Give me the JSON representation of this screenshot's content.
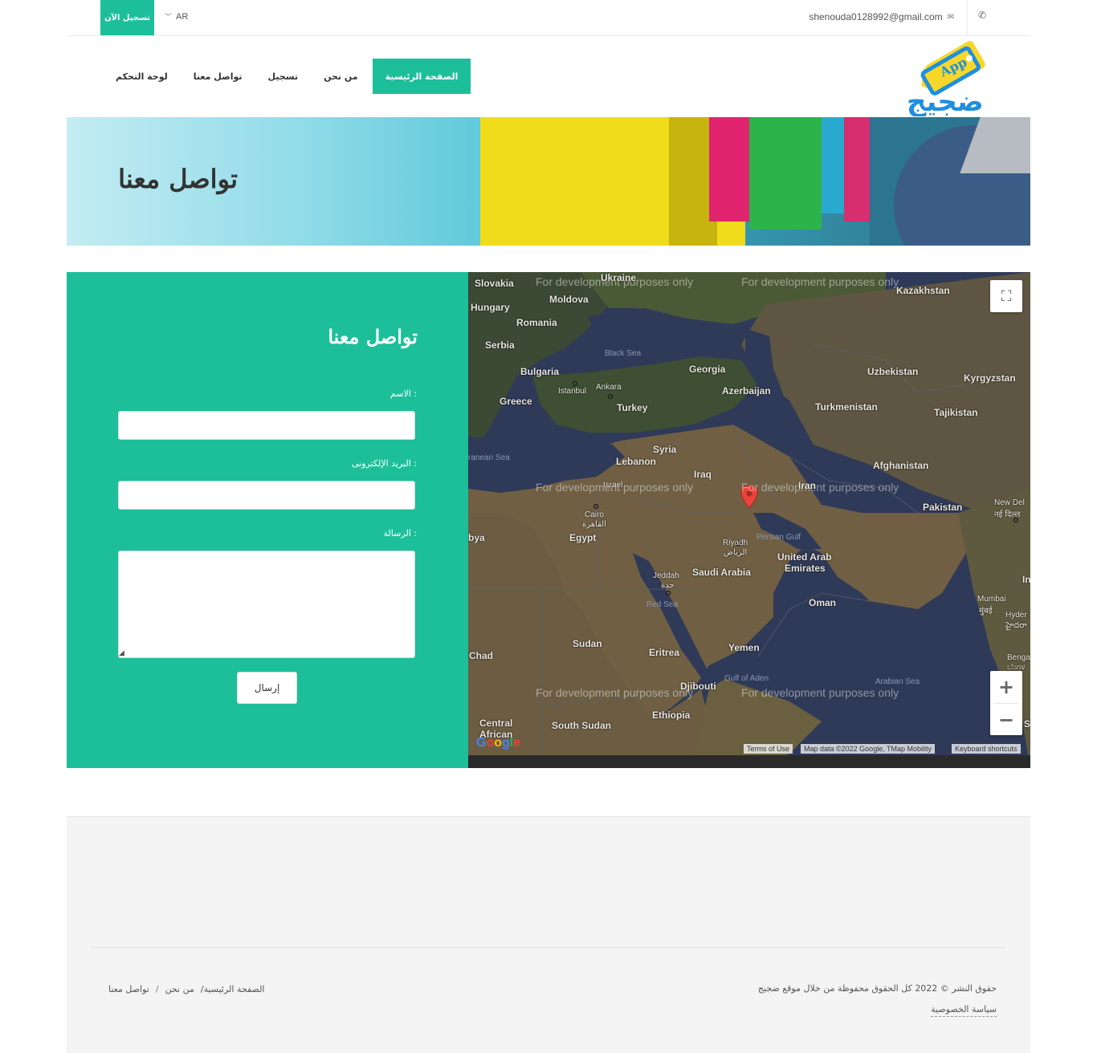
{
  "topbar": {
    "register_label": "تسجيل الآن",
    "language": "AR",
    "email": "shenouda0128992@gmail.com"
  },
  "nav": {
    "items": [
      {
        "label": "لوحة التحكم"
      },
      {
        "label": "تواصل معنا"
      },
      {
        "label": "تسجيل"
      },
      {
        "label": "من نحن"
      },
      {
        "label": "الصفحة الرئيسية",
        "active": true
      }
    ]
  },
  "logo": {
    "text": "ضجيج",
    "badge": "App"
  },
  "banner": {
    "title": "تواصل معنا"
  },
  "contact": {
    "title": "تواصل معنا",
    "name_label": "الاسم :",
    "email_label": "البريد الإلكترونى :",
    "message_label": "الرسالة :",
    "send_label": "إرسال"
  },
  "map": {
    "watermark": "For development purposes only",
    "labels": {
      "slovakia": "Slovakia",
      "ukraine": "Ukraine",
      "moldova": "Moldova",
      "hungary": "Hungary",
      "romania": "Romania",
      "serbia": "Serbia",
      "bulgaria": "Bulgaria",
      "greece": "Greece",
      "black_sea": "Black Sea",
      "georgia": "Georgia",
      "istanbul": "Istanbul",
      "ankara": "Ankara",
      "turkey": "Turkey",
      "azerbaijan": "Azerbaijan",
      "kazakhstan": "Kazakhstan",
      "uzbekistan": "Uzbekistan",
      "kyrgyzstan": "Kyrgyzstan",
      "turkmenistan": "Turkmenistan",
      "tajikistan": "Tajikistan",
      "med_sea": "ranean Sea",
      "syria": "Syria",
      "lebanon": "Lebanon",
      "iraq": "Iraq",
      "israel": "Israel",
      "afghanistan": "Afghanistan",
      "iran": "Iran",
      "pakistan": "Pakistan",
      "new_delhi": "New Del",
      "new_delhi_hi": "नई दिल्ल",
      "cairo": "Cairo",
      "cairo_ar": "القاهرة",
      "egypt": "Egypt",
      "libya": "bya",
      "riyadh": "Riyadh",
      "riyadh_ar": "الرياض",
      "persian_gulf": "Persian Gulf",
      "uae1": "United Arab",
      "uae2": "Emirates",
      "saudi": "Saudi Arabia",
      "jeddah": "Jeddah",
      "jeddah_ar": "جدة",
      "red_sea": "Red Sea",
      "oman": "Oman",
      "mumbai": "Mumbai",
      "mumbai_hi": "मुंबई",
      "hyder": "Hyder",
      "hyder_te": "హైదరా",
      "india": "In",
      "sudan": "Sudan",
      "eritrea": "Eritrea",
      "yemen": "Yemen",
      "chad": "Chad",
      "gulf_aden": "Gulf of Aden",
      "djibouti": "Djibouti",
      "arabian_sea": "Arabian Sea",
      "bengal": "Bengal",
      "bengal_kn": "ಬೆಂಗಳ",
      "ethiopia": "Ethiopia",
      "central1": "Central",
      "central2": "African",
      "south_sudan": "South Sudan",
      "s_edge": "S"
    },
    "attribution": {
      "terms": "Terms of Use",
      "mapdata": "Map data ©2022 Google, TMap Mobility",
      "shortcuts": "Keyboard shortcuts"
    },
    "google": "Google"
  },
  "footer": {
    "copyright": "حقوق النشر © 2022 كل الحقوق محفوظة من خلال موقع ضجيج",
    "privacy": "سياسة الخصوصية",
    "breadcrumbs": [
      "الصفحة الرئيسية/",
      "من نحن",
      "/",
      "تواصل معنا"
    ]
  },
  "colors": {
    "accent": "#1dbf9a",
    "logo_blue": "#1e8fe0",
    "logo_yellow": "#f6d728"
  }
}
